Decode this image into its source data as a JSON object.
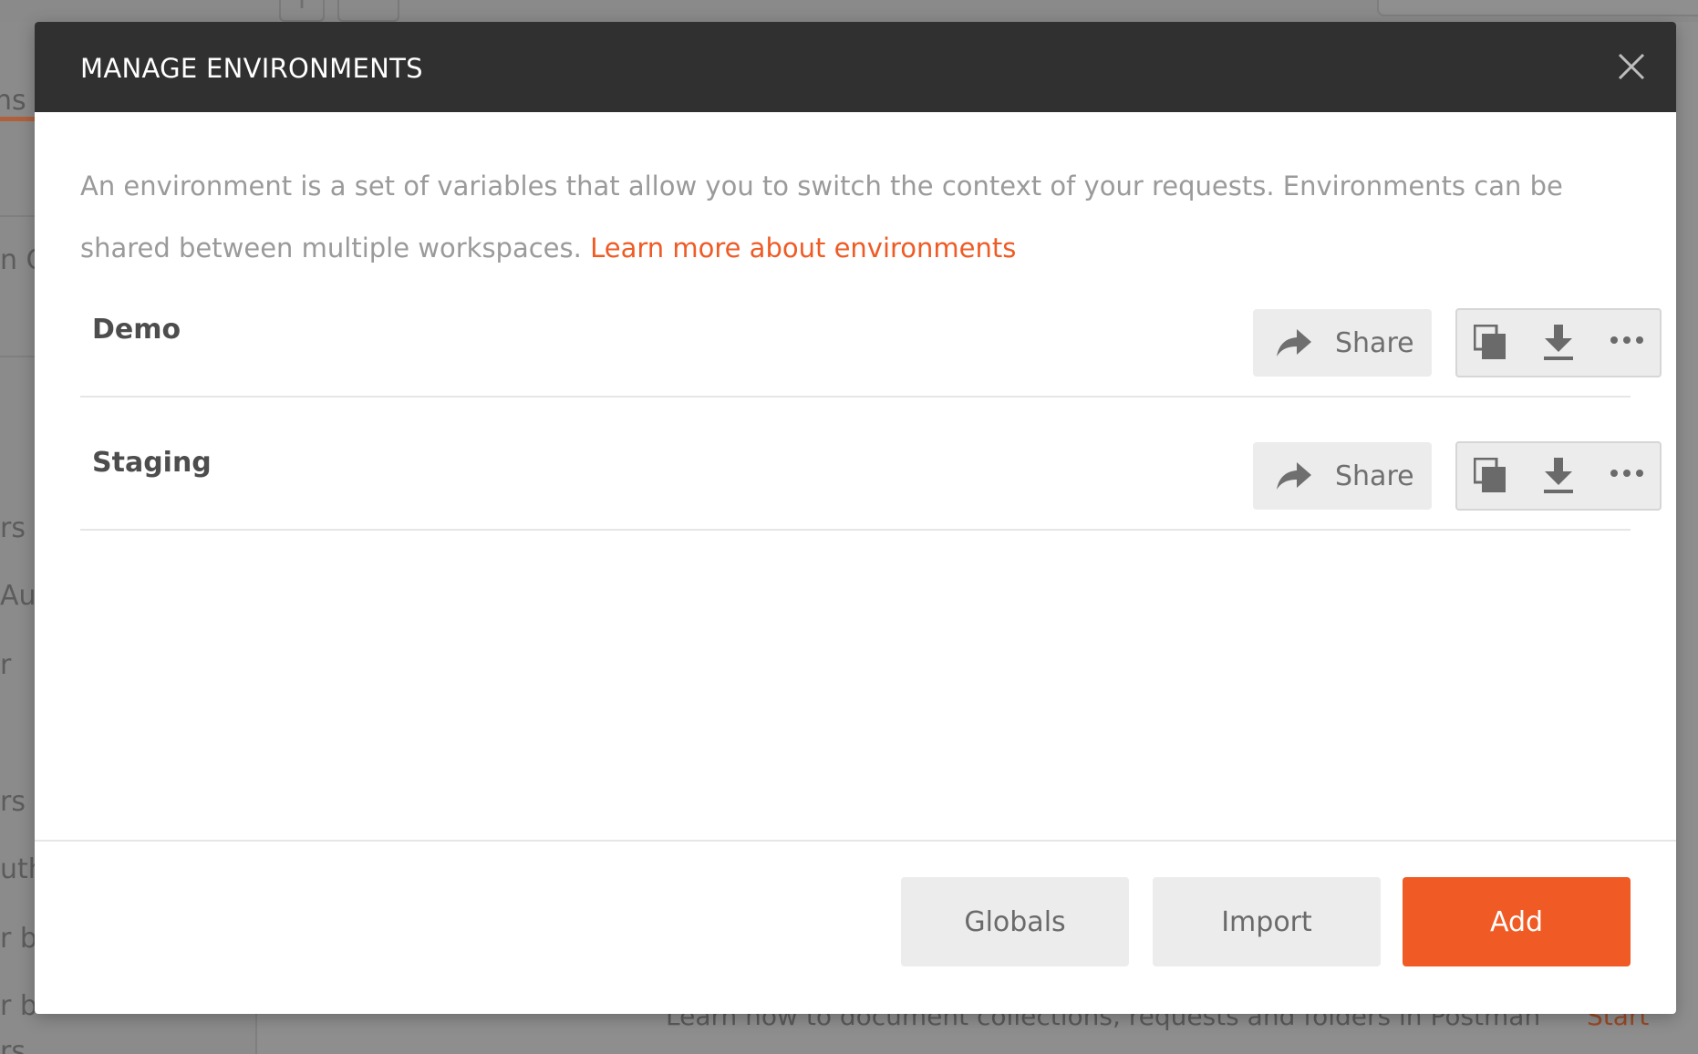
{
  "background": {
    "sidebar_tab_label": "ns",
    "sidebar_fragments": [
      "n C",
      "rs",
      "Aut",
      "r",
      "rs",
      "uthe",
      "r by",
      "r by",
      "rs in ANS f"
    ],
    "bottom_hint": "Learn how to document collections, requests and folders in Postman",
    "bottom_start": "Start"
  },
  "modal": {
    "title": "MANAGE ENVIRONMENTS",
    "close_icon": "close-icon",
    "description": "An environment is a set of variables that allow you to switch the context of your requests. Environments can be shared between multiple workspaces.",
    "learn_more_link": "Learn more about environments",
    "environments": [
      {
        "name": "Demo",
        "share_label": "Share"
      },
      {
        "name": "Staging",
        "share_label": "Share"
      }
    ],
    "footer": {
      "globals_label": "Globals",
      "import_label": "Import",
      "add_label": "Add"
    },
    "colors": {
      "header_bg": "#303030",
      "accent": "#f05a24",
      "link": "#ef5b25",
      "button_bg": "#ececec"
    }
  }
}
